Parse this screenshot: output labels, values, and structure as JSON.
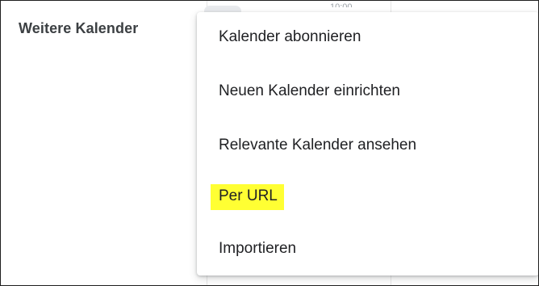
{
  "sidebar": {
    "section_title": "Weitere Kalender"
  },
  "background": {
    "time_label": "10:00"
  },
  "menu": {
    "items": [
      {
        "label": "Kalender abonnieren"
      },
      {
        "label": "Neuen Kalender einrichten"
      },
      {
        "label": "Relevante Kalender ansehen"
      },
      {
        "label": "Per URL",
        "highlight_color": "#ffff33"
      },
      {
        "label": "Importieren"
      }
    ]
  }
}
